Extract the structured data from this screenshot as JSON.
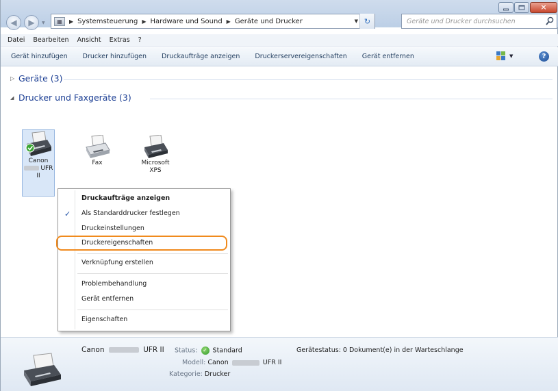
{
  "window": {
    "address": {
      "crumbs": [
        "Systemsteuerung",
        "Hardware und Sound",
        "Geräte und Drucker"
      ],
      "search_placeholder": "Geräte und Drucker durchsuchen"
    },
    "menubar": [
      "Datei",
      "Bearbeiten",
      "Ansicht",
      "Extras",
      "?"
    ],
    "commands": [
      "Gerät hinzufügen",
      "Drucker hinzufügen",
      "Druckaufträge anzeigen",
      "Druckerservereigenschaften",
      "Gerät entfernen"
    ]
  },
  "groups": {
    "devices": {
      "label": "Geräte (3)",
      "expanded": false
    },
    "printers": {
      "label": "Drucker und Faxgeräte (3)",
      "expanded": true
    }
  },
  "printers": [
    {
      "line1": "Canon",
      "line2": "UFR",
      "line3": "II",
      "selected": true,
      "default": true
    },
    {
      "line1": "Fax",
      "line2": "",
      "line3": "",
      "selected": false,
      "default": false
    },
    {
      "line1": "Microsoft",
      "line2": "XPS",
      "line3": "",
      "selected": false,
      "default": false
    }
  ],
  "context_menu": {
    "items": [
      {
        "label": "Druckaufträge anzeigen",
        "bold": true
      },
      {
        "label": "Als Standarddrucker festlegen",
        "checked": true
      },
      {
        "label": "Druckeinstellungen"
      },
      {
        "label": "Druckereigenschaften",
        "highlighted": true
      },
      {
        "label": "Verknüpfung erstellen"
      },
      {
        "label": "Problembehandlung"
      },
      {
        "label": "Gerät entfernen"
      },
      {
        "label": "Eigenschaften"
      }
    ],
    "highlight_color": "#f08a1d"
  },
  "details": {
    "name_prefix": "Canon",
    "name_suffix": "UFR II",
    "status_key": "Status:",
    "status_value": "Standard",
    "model_key": "Modell:",
    "model_prefix": "Canon",
    "model_suffix": "UFR II",
    "category_key": "Kategorie:",
    "category_value": "Drucker",
    "device_status": "Gerätestatus: 0 Dokument(e) in der Warteschlange"
  },
  "colors": {
    "group_label": "#1c3f94",
    "selection": "#d9e7f8",
    "check": "#1f4fa6"
  }
}
